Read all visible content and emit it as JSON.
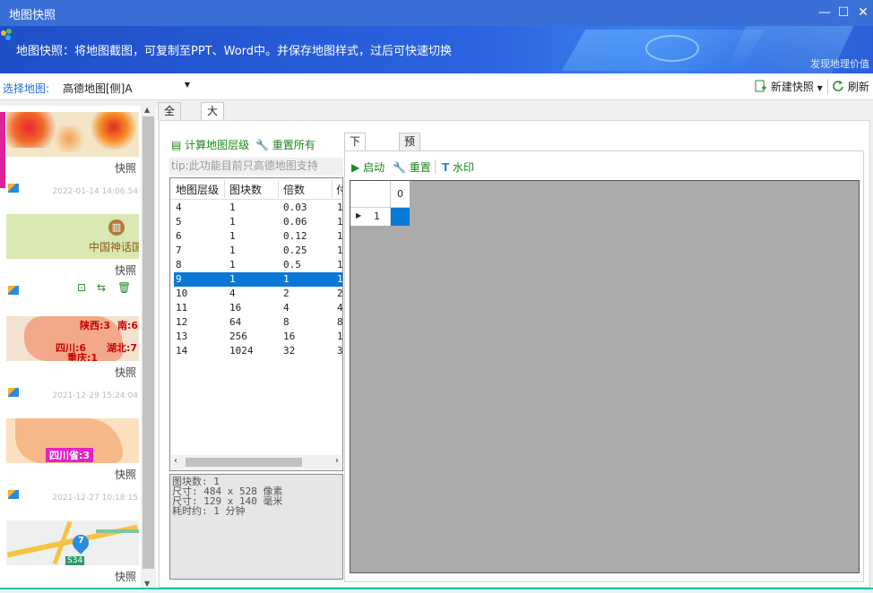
{
  "window": {
    "title": "地图快照",
    "controls": {
      "minimize": "—",
      "maximize": "☐",
      "close": "✕"
    }
  },
  "banner": {
    "description": "地图快照：将地图截图，可复制至PPT、Word中。并保存地图样式，过后可快速切换",
    "brand": "发现地理价值"
  },
  "toolbar": {
    "select_label": "选择地图:",
    "map_value": "高德地图[侧]A",
    "new_snapshot": "新建快照",
    "refresh": "刷新"
  },
  "snapshots": [
    {
      "label": "快照",
      "date": "2022-01-14 14:06:54",
      "kind": "heat"
    },
    {
      "label": "快照",
      "date": "",
      "kind": "museum",
      "place": "中国神话国",
      "actions": [
        "preview-icon",
        "swap-icon",
        "delete-icon"
      ]
    },
    {
      "label": "快照",
      "date": "2021-12-29 15:24:04",
      "kind": "provinces",
      "regions": [
        "陕西:3",
        "南:6",
        "四川:6",
        "湖北:7",
        "重庆:1"
      ]
    },
    {
      "label": "快照",
      "date": "2021-12-27 10:18:15",
      "kind": "sichuan",
      "region": "四川省:3"
    },
    {
      "label": "快照",
      "date": "",
      "kind": "route",
      "pin": "7",
      "road": "S34"
    }
  ],
  "main_tabs": [
    "全图",
    "大图"
  ],
  "main_tab_active": 1,
  "layer_panel": {
    "compute_label": "计算地图层级",
    "reset_all_label": "重置所有",
    "tip": "tip:此功能目前只高德地图支持",
    "columns": [
      "地图层级",
      "图块数",
      "倍数",
      "付"
    ],
    "rows": [
      [
        "4",
        "1",
        "0.03",
        "1"
      ],
      [
        "5",
        "1",
        "0.06",
        "1"
      ],
      [
        "6",
        "1",
        "0.12",
        "1"
      ],
      [
        "7",
        "1",
        "0.25",
        "1"
      ],
      [
        "8",
        "1",
        "0.5",
        "1"
      ],
      [
        "9",
        "1",
        "1",
        "1"
      ],
      [
        "10",
        "4",
        "2",
        "2"
      ],
      [
        "11",
        "16",
        "4",
        "4"
      ],
      [
        "12",
        "64",
        "8",
        "8"
      ],
      [
        "13",
        "256",
        "16",
        "1"
      ],
      [
        "14",
        "1024",
        "32",
        "3"
      ]
    ],
    "selected_row": 5
  },
  "info": {
    "lines": [
      "图块数: 1",
      "尺寸: 484 x 528 像素",
      "尺寸: 129 x 140 毫米",
      "耗时约: 1 分钟"
    ]
  },
  "sub_tabs": [
    "下载进度",
    "预览"
  ],
  "sub_tab_active": 0,
  "progress": {
    "start": "启动",
    "reset": "重置",
    "watermark": "水印",
    "column": "0",
    "row": "1"
  }
}
